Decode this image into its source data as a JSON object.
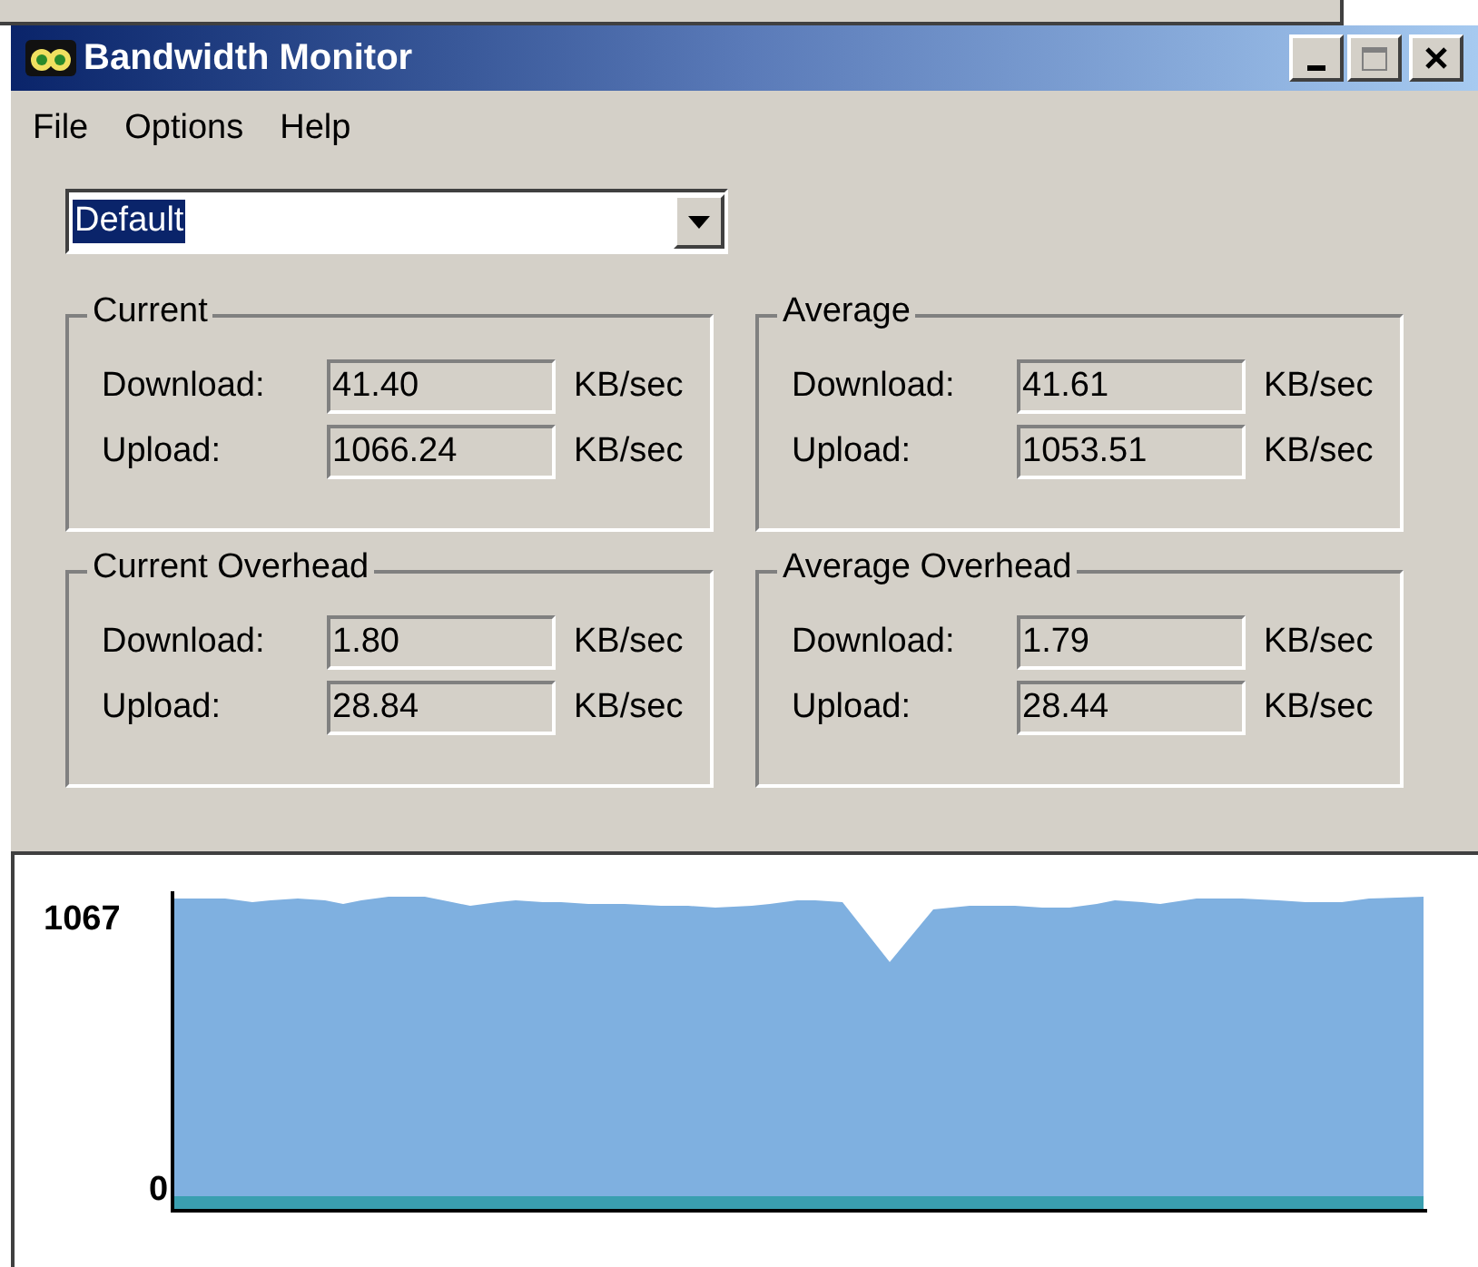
{
  "window": {
    "title": "Bandwidth Monitor"
  },
  "menu": [
    "File",
    "Options",
    "Help"
  ],
  "profile": {
    "value": "Default"
  },
  "groups": [
    {
      "title": "Current",
      "rows": [
        {
          "label": "Download:",
          "value": "41.40",
          "unit": "KB/sec"
        },
        {
          "label": "Upload:",
          "value": "1066.24",
          "unit": "KB/sec"
        }
      ]
    },
    {
      "title": "Average",
      "rows": [
        {
          "label": "Download:",
          "value": "41.61",
          "unit": "KB/sec"
        },
        {
          "label": "Upload:",
          "value": "1053.51",
          "unit": "KB/sec"
        }
      ]
    },
    {
      "title": "Current Overhead",
      "rows": [
        {
          "label": "Download:",
          "value": "1.80",
          "unit": "KB/sec"
        },
        {
          "label": "Upload:",
          "value": "28.84",
          "unit": "KB/sec"
        }
      ]
    },
    {
      "title": "Average Overhead",
      "rows": [
        {
          "label": "Download:",
          "value": "1.79",
          "unit": "KB/sec"
        },
        {
          "label": "Upload:",
          "value": "28.44",
          "unit": "KB/sec"
        }
      ]
    }
  ],
  "graph": {
    "max_label": "1067",
    "min_label": "0"
  }
}
